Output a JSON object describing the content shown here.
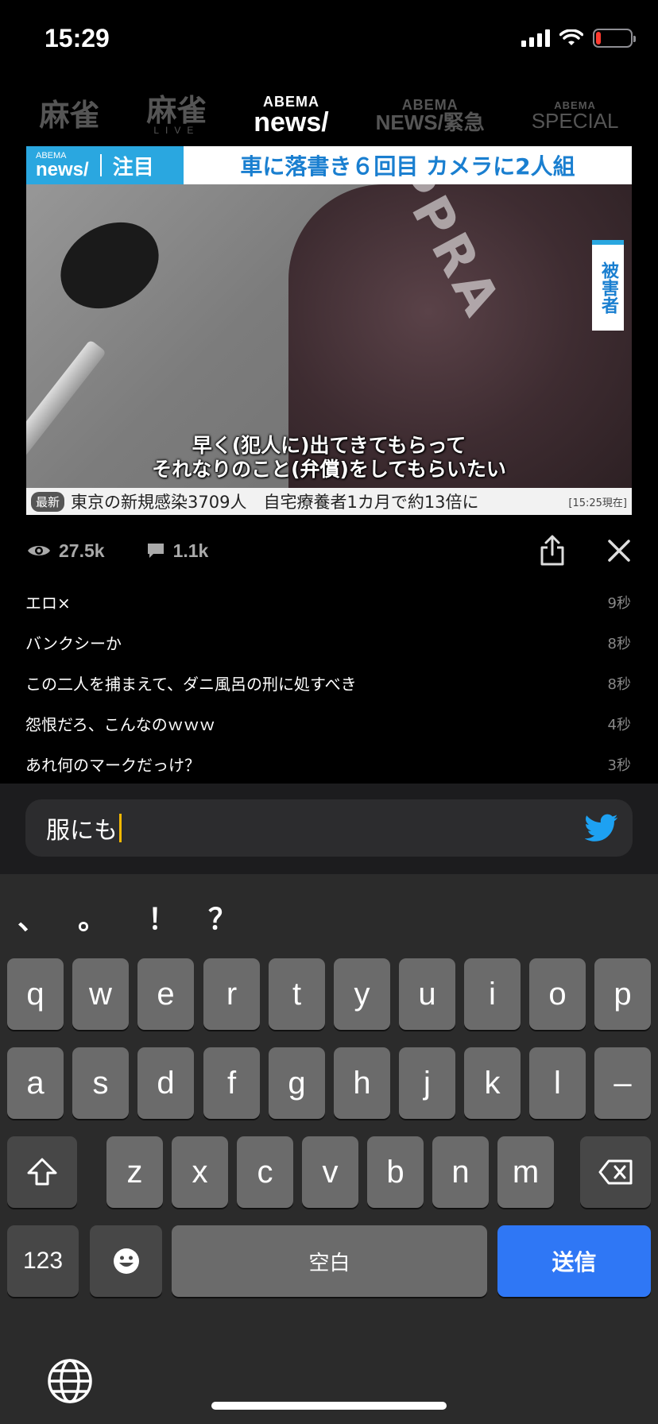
{
  "status": {
    "time": "15:29",
    "battery_level": 0.15,
    "battery_color": "#ff3b30"
  },
  "channels": [
    {
      "top": "",
      "main": "麻雀",
      "sub": "",
      "active": false
    },
    {
      "top": "",
      "main": "麻雀",
      "sub": "LIVE",
      "active": false
    },
    {
      "top": "ABEMA",
      "main": "news/",
      "sub": "",
      "active": true
    },
    {
      "top": "ABEMA",
      "main": "NEWS/緊急",
      "sub": "",
      "active": false
    },
    {
      "top": "ABEMA",
      "main": "SPECIAL",
      "sub": "",
      "active": false
    }
  ],
  "video": {
    "logo_top": "ABEMA",
    "logo_main": "news/",
    "category": "注目",
    "headline": "車に落書き６回目 カメラに2人組",
    "side_label": "被害者",
    "jacket_text": "PPRA",
    "caption_line1": "早く(犯人に)出てきてもらって",
    "caption_line2": "それなりのこと(弁償)をしてもらいたい",
    "ticker_badge": "最新",
    "ticker_text": "東京の新規感染3709人　自宅療養者1カ月で約13倍に",
    "ticker_time": "[15:25現在]"
  },
  "stats": {
    "views": "27.5k",
    "comments": "1.1k"
  },
  "comments": [
    {
      "text": "エロ×",
      "time": "9秒"
    },
    {
      "text": "バンクシーか",
      "time": "8秒"
    },
    {
      "text": "この二人を捕まえて、ダニ風呂の刑に処すべき",
      "time": "8秒"
    },
    {
      "text": "怨恨だろ、こんなのｗｗｗ",
      "time": "4秒"
    },
    {
      "text": "あれ何のマークだっけ？",
      "time": "3秒"
    }
  ],
  "input": {
    "value": "服にも"
  },
  "keyboard": {
    "punct": [
      "、",
      "。",
      "！",
      "？"
    ],
    "row1": [
      "q",
      "w",
      "e",
      "r",
      "t",
      "y",
      "u",
      "i",
      "o",
      "p"
    ],
    "row2": [
      "a",
      "s",
      "d",
      "f",
      "g",
      "h",
      "j",
      "k",
      "l",
      "–"
    ],
    "row3": [
      "z",
      "x",
      "c",
      "v",
      "b",
      "n",
      "m"
    ],
    "num_label": "123",
    "space_label": "空白",
    "send_label": "送信"
  },
  "colors": {
    "accent_blue": "#2f77f5",
    "abema_blue": "#2aa7e0",
    "twitter_blue": "#1da1f2",
    "caret": "#f5b800"
  }
}
